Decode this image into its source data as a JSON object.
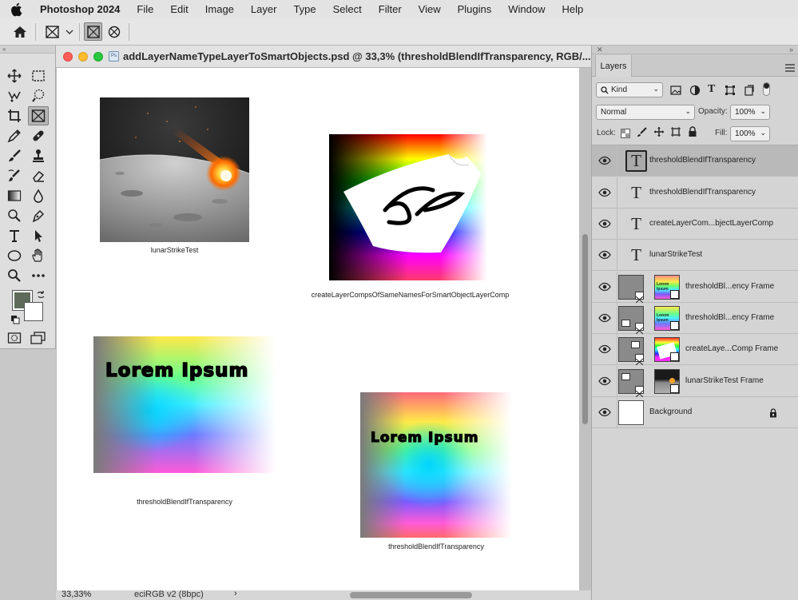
{
  "menubar": {
    "app": "Photoshop 2024",
    "items": [
      "File",
      "Edit",
      "Image",
      "Layer",
      "Type",
      "Select",
      "Filter",
      "View",
      "Plugins",
      "Window",
      "Help"
    ]
  },
  "document": {
    "title": "addLayerNameTypeLayerToSmartObjects.psd @ 33,3% (thresholdBlendIfTransparency, RGB/...",
    "file_badge": "Ps",
    "zoom": "33,33%",
    "profile": "eciRGB v2 (8bpc)",
    "status_arrow": "›"
  },
  "canvas": {
    "captions": {
      "lunar": "lunarStrike​Test",
      "comps": "createLayerCompsOfSameNamesForSmartObjectLayerComp",
      "threshold_left": "thresholdBlendIfTransparency",
      "threshold_right": "thresholdBlendIfTransparency"
    },
    "lorem_left": "Lorem Ipsum",
    "lorem_right": "Lorem Ipsum"
  },
  "layers_panel": {
    "tab": "Layers",
    "filter_kind": "Kind",
    "blend_mode": "Normal",
    "opacity_label": "Opacity:",
    "opacity_value": "100%",
    "lock_label": "Lock:",
    "fill_label": "Fill:",
    "fill_value": "100%",
    "layers": [
      {
        "name": "thresholdBlendIfTransparency",
        "kind": "text",
        "selected": true
      },
      {
        "name": "thresholdBlendIfTransparency",
        "kind": "text",
        "selected": false
      },
      {
        "name": "createLayerCom...bjectLayerComp",
        "kind": "text",
        "selected": false
      },
      {
        "name": "lunarStrikeTest",
        "kind": "text",
        "selected": false
      },
      {
        "name": "thresholdBl...ency Frame",
        "kind": "frame",
        "selected": false
      },
      {
        "name": "thresholdBl...ency Frame",
        "kind": "frame",
        "selected": false
      },
      {
        "name": "createLaye...Comp Frame",
        "kind": "frame",
        "selected": false
      },
      {
        "name": "lunarStrikeTest Frame",
        "kind": "frame",
        "selected": false
      },
      {
        "name": "Background",
        "kind": "background",
        "selected": false
      }
    ]
  },
  "colors": {
    "foreground": "#5f6b5a",
    "background": "#ffffff",
    "selected_layer": "#b9b9b9"
  }
}
